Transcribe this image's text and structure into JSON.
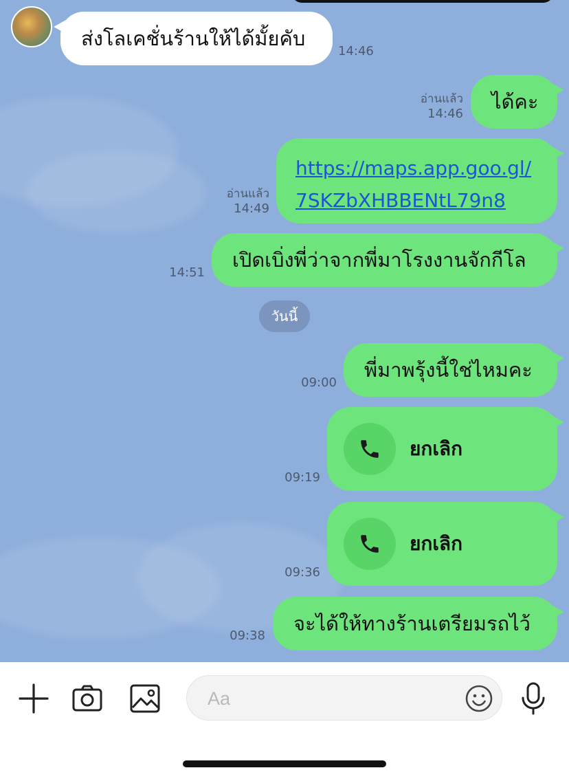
{
  "colors": {
    "chat_background": "#8eaedb",
    "outgoing_bubble": "#6ee57c",
    "incoming_bubble": "#ffffff",
    "link": "#1b55d6",
    "date_pill": "#6e82a5"
  },
  "messages": {
    "m1": {
      "text": "ส่งโลเคชั่นร้านให้ได้มั้ยคับ",
      "time": "14:46",
      "direction": "incoming"
    },
    "m2": {
      "text": "ได้คะ",
      "read": "อ่านแล้ว",
      "time": "14:46",
      "direction": "outgoing"
    },
    "m3": {
      "link_line1": "https://maps.app.goo.gl/",
      "link_line2": "7SKZbXHBBENtL79n8",
      "read": "อ่านแล้ว",
      "time": "14:49",
      "direction": "outgoing"
    },
    "m4": {
      "text": "เปิดเบิ่งพี่ว่าจากพี่มาโรงงานจักกีโล",
      "time": "14:51",
      "direction": "outgoing"
    },
    "date_separator": "วันนี้",
    "m5": {
      "text": "พี่มาพรุ้งนี้ใช่ไหมคะ",
      "time": "09:00",
      "direction": "outgoing"
    },
    "m6": {
      "call_label": "ยกเลิก",
      "icon": "phone-icon",
      "time": "09:19",
      "direction": "outgoing"
    },
    "m7": {
      "call_label": "ยกเลิก",
      "icon": "phone-icon",
      "time": "09:36",
      "direction": "outgoing"
    },
    "m8": {
      "text": "จะได้ให้ทางร้านเตรียมรถไว้",
      "time": "09:38",
      "direction": "outgoing"
    }
  },
  "composer": {
    "add_icon": "plus-icon",
    "camera_icon": "camera-icon",
    "gallery_icon": "image-icon",
    "placeholder": "Aa",
    "emoji_icon": "smiley-icon",
    "mic_icon": "microphone-icon"
  }
}
